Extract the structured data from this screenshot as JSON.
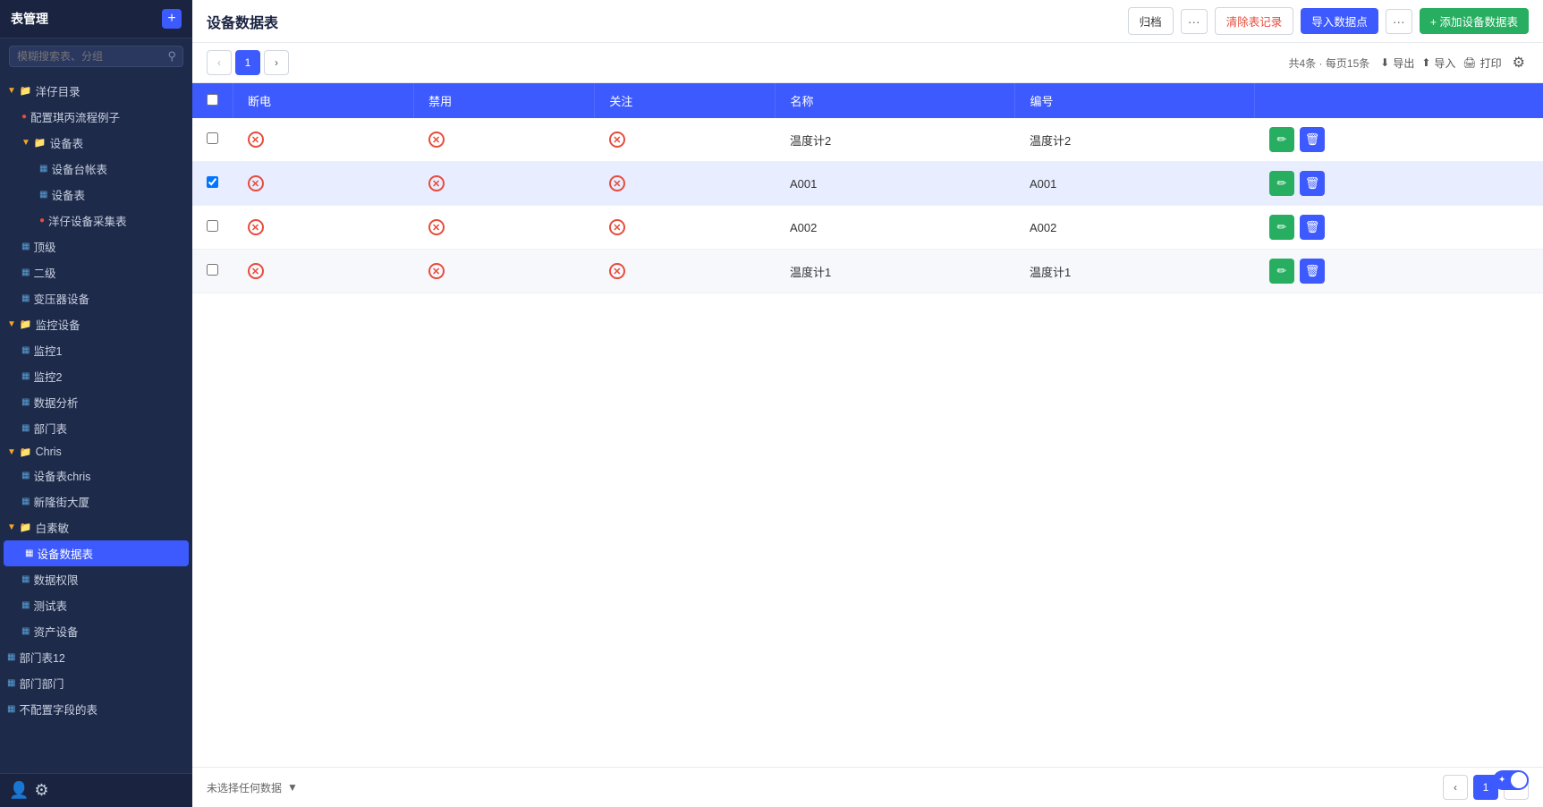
{
  "sidebar": {
    "title": "表管理",
    "add_label": "+",
    "search_placeholder": "模糊搜索表、分组",
    "items": [
      {
        "id": "yangzai-dir",
        "label": "洋仔目录",
        "type": "folder",
        "level": 0,
        "expanded": true
      },
      {
        "id": "config-qiong",
        "label": "配置琪丙流程例子",
        "type": "table-special",
        "level": 1
      },
      {
        "id": "device-table-dir",
        "label": "设备表",
        "type": "folder",
        "level": 1,
        "expanded": true
      },
      {
        "id": "device-account",
        "label": "设备台帐表",
        "type": "table",
        "level": 2
      },
      {
        "id": "device-table",
        "label": "设备表",
        "type": "table",
        "level": 2
      },
      {
        "id": "yangzai-device",
        "label": "洋仔设备采集表",
        "type": "table-special2",
        "level": 2
      },
      {
        "id": "top-level",
        "label": "顶级",
        "type": "table",
        "level": 1
      },
      {
        "id": "second-level",
        "label": "二级",
        "type": "table",
        "level": 1
      },
      {
        "id": "transformer",
        "label": "变压器设备",
        "type": "table",
        "level": 1
      },
      {
        "id": "monitor-dir",
        "label": "监控设备",
        "type": "folder",
        "level": 0,
        "expanded": true
      },
      {
        "id": "monitor1",
        "label": "监控1",
        "type": "table",
        "level": 1
      },
      {
        "id": "monitor2",
        "label": "监控2",
        "type": "table",
        "level": 1
      },
      {
        "id": "data-analysis",
        "label": "数据分析",
        "type": "table",
        "level": 1
      },
      {
        "id": "dept-table",
        "label": "部门表",
        "type": "table",
        "level": 1
      },
      {
        "id": "chris-dir",
        "label": "Chris",
        "type": "folder",
        "level": 0,
        "expanded": true
      },
      {
        "id": "device-chris",
        "label": "设备表chris",
        "type": "table",
        "level": 1
      },
      {
        "id": "xinlong-building",
        "label": "新隆街大厦",
        "type": "table",
        "level": 1
      },
      {
        "id": "baisumin-dir",
        "label": "白素敏",
        "type": "folder",
        "level": 0,
        "expanded": true
      },
      {
        "id": "device-data",
        "label": "设备数据表",
        "type": "table",
        "level": 1,
        "active": true
      },
      {
        "id": "data-auth",
        "label": "数据权限",
        "type": "table",
        "level": 1
      },
      {
        "id": "test-table",
        "label": "测试表",
        "type": "table",
        "level": 1
      },
      {
        "id": "asset-device",
        "label": "资产设备",
        "type": "table",
        "level": 1
      },
      {
        "id": "dept-table12",
        "label": "部门表12",
        "type": "table",
        "level": 0
      },
      {
        "id": "dept-dept",
        "label": "部门部门",
        "type": "table",
        "level": 0
      },
      {
        "id": "no-field-table",
        "label": "不配置字段的表",
        "type": "table",
        "level": 0
      }
    ]
  },
  "header": {
    "title": "设备数据表",
    "btn_archive": "归档",
    "btn_clear": "清除表记录",
    "btn_import_data": "导入数据点",
    "btn_add": "+ 添加设备数据表"
  },
  "toolbar": {
    "total_label": "共4条",
    "per_page_label": "每页15条",
    "btn_export": "导出",
    "btn_import": "导入",
    "btn_print": "打印"
  },
  "pagination": {
    "current_page": 1,
    "prev_disabled": true,
    "next_disabled": true,
    "page_label": "1"
  },
  "table": {
    "columns": [
      {
        "id": "checkbox",
        "label": ""
      },
      {
        "id": "power_off",
        "label": "断电"
      },
      {
        "id": "disable",
        "label": "禁用"
      },
      {
        "id": "follow",
        "label": "关注"
      },
      {
        "id": "name",
        "label": "名称"
      },
      {
        "id": "code",
        "label": "编号"
      },
      {
        "id": "actions",
        "label": ""
      }
    ],
    "rows": [
      {
        "id": 1,
        "power_off": "x",
        "disable": "x",
        "follow": "x",
        "name": "温度计2",
        "code": "温度计2",
        "selected": false
      },
      {
        "id": 2,
        "power_off": "x",
        "disable": "x",
        "follow": "x",
        "name": "A001",
        "code": "A001",
        "selected": true
      },
      {
        "id": 3,
        "power_off": "x",
        "disable": "x",
        "follow": "x",
        "name": "A002",
        "code": "A002",
        "selected": false
      },
      {
        "id": 4,
        "power_off": "x",
        "disable": "x",
        "follow": "x",
        "name": "温度计1",
        "code": "温度计1",
        "selected": false
      }
    ]
  },
  "bottom": {
    "no_selection_label": "未选择任何数据",
    "page_label": "1"
  },
  "colors": {
    "sidebar_bg": "#1e2a4a",
    "header_bg": "#3d5afe",
    "active_item": "#3d5afe",
    "x_icon": "#e74c3c",
    "edit_btn": "#27ae60",
    "delete_btn": "#3d5afe"
  }
}
